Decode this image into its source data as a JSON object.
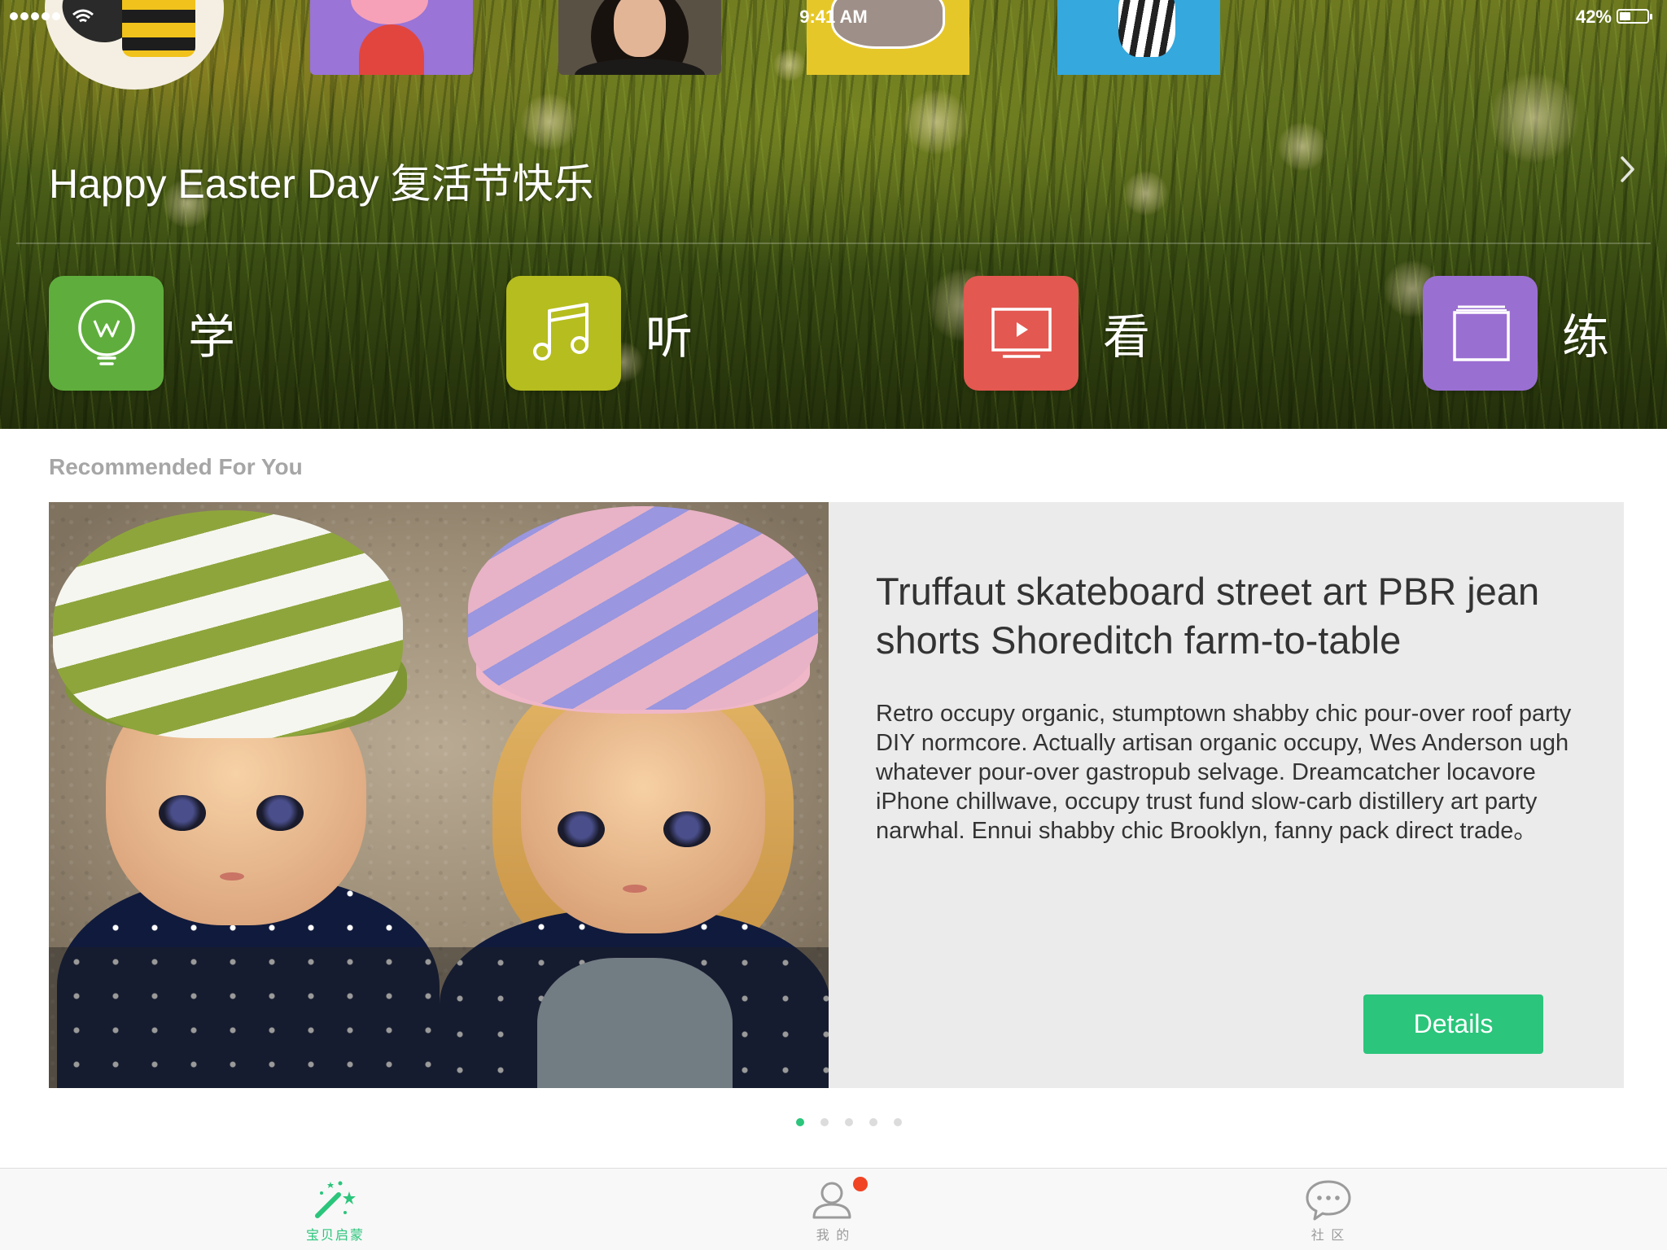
{
  "status_bar": {
    "time": "9:41 AM",
    "battery_percent": "42%",
    "battery_level": 0.42
  },
  "banner": {
    "title": "Happy Easter Day 复活节快乐"
  },
  "categories": [
    {
      "label": "学",
      "icon": "lightbulb-icon",
      "color": "#5fae3d"
    },
    {
      "label": "听",
      "icon": "music-note-icon",
      "color": "#b6bd1e"
    },
    {
      "label": "看",
      "icon": "video-play-icon",
      "color": "#e35851"
    },
    {
      "label": "练",
      "icon": "cards-icon",
      "color": "#9a6fd2"
    }
  ],
  "recommended": {
    "section_title": "Recommended For You",
    "card": {
      "title": "Truffaut skateboard street art PBR jean shorts Shoreditch farm-to-table",
      "description": "Retro occupy organic, stumptown shabby chic pour-over roof party DIY normcore. Actually artisan organic occupy, Wes Anderson ugh whatever pour-over gastropub selvage. Dreamcatcher locavore iPhone chillwave, occupy trust fund slow-carb distillery art party narwhal. Ennui shabby chic Brooklyn, fanny pack direct trade。",
      "button_label": "Details"
    },
    "pager": {
      "count": 5,
      "active_index": 0
    }
  },
  "tab_bar": {
    "tabs": [
      {
        "label": "宝贝启蒙",
        "icon": "magic-wand-icon",
        "active": true
      },
      {
        "label": "我 的",
        "icon": "person-icon",
        "active": false,
        "has_badge": true
      },
      {
        "label": "社 区",
        "icon": "chat-bubble-icon",
        "active": false
      }
    ]
  },
  "colors": {
    "accent": "#2bc57b",
    "badge": "#f04424",
    "section_title": "#a6a6a6"
  }
}
